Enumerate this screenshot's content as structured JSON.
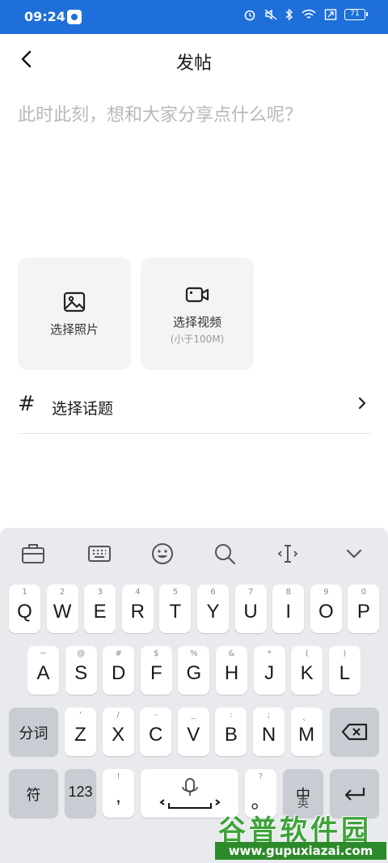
{
  "status_bar": {
    "time": "09:24",
    "battery": "71"
  },
  "header": {
    "title": "发帖"
  },
  "compose": {
    "placeholder": "此时此刻，想和大家分享点什么呢？"
  },
  "media": {
    "photo_label": "选择照片",
    "video_label": "选择视频",
    "video_note": "(小于100M)"
  },
  "topic": {
    "hash": "#",
    "label": "选择话题"
  },
  "keyboard": {
    "row1": [
      {
        "hint": "1",
        "key": "Q"
      },
      {
        "hint": "2",
        "key": "W"
      },
      {
        "hint": "3",
        "key": "E"
      },
      {
        "hint": "4",
        "key": "R"
      },
      {
        "hint": "5",
        "key": "T"
      },
      {
        "hint": "6",
        "key": "Y"
      },
      {
        "hint": "7",
        "key": "U"
      },
      {
        "hint": "8",
        "key": "I"
      },
      {
        "hint": "9",
        "key": "O"
      },
      {
        "hint": "0",
        "key": "P"
      }
    ],
    "row2": [
      {
        "hint": "~",
        "key": "A"
      },
      {
        "hint": "@",
        "key": "S"
      },
      {
        "hint": "#",
        "key": "D"
      },
      {
        "hint": "$",
        "key": "F"
      },
      {
        "hint": "%",
        "key": "G"
      },
      {
        "hint": "&",
        "key": "H"
      },
      {
        "hint": "*",
        "key": "J"
      },
      {
        "hint": "(",
        "key": "K"
      },
      {
        "hint": ")",
        "key": "L"
      }
    ],
    "row3": [
      {
        "hint": "'",
        "key": "Z"
      },
      {
        "hint": "/",
        "key": "X"
      },
      {
        "hint": "-",
        "key": "C"
      },
      {
        "hint": "_",
        "key": "V"
      },
      {
        "hint": ":",
        "key": "B"
      },
      {
        "hint": ";",
        "key": "N"
      },
      {
        "hint": "、",
        "key": "M"
      }
    ],
    "segment_label": "分词",
    "symbol_label": "符",
    "num_label": "123",
    "comma_key": ",",
    "comma_hint": "!",
    "period_key": "。",
    "period_hint": "?",
    "lang_top": "中",
    "lang_bottom": "英"
  },
  "watermark": {
    "title": "谷普软件园",
    "url": "www.gupuxiazai.com"
  }
}
